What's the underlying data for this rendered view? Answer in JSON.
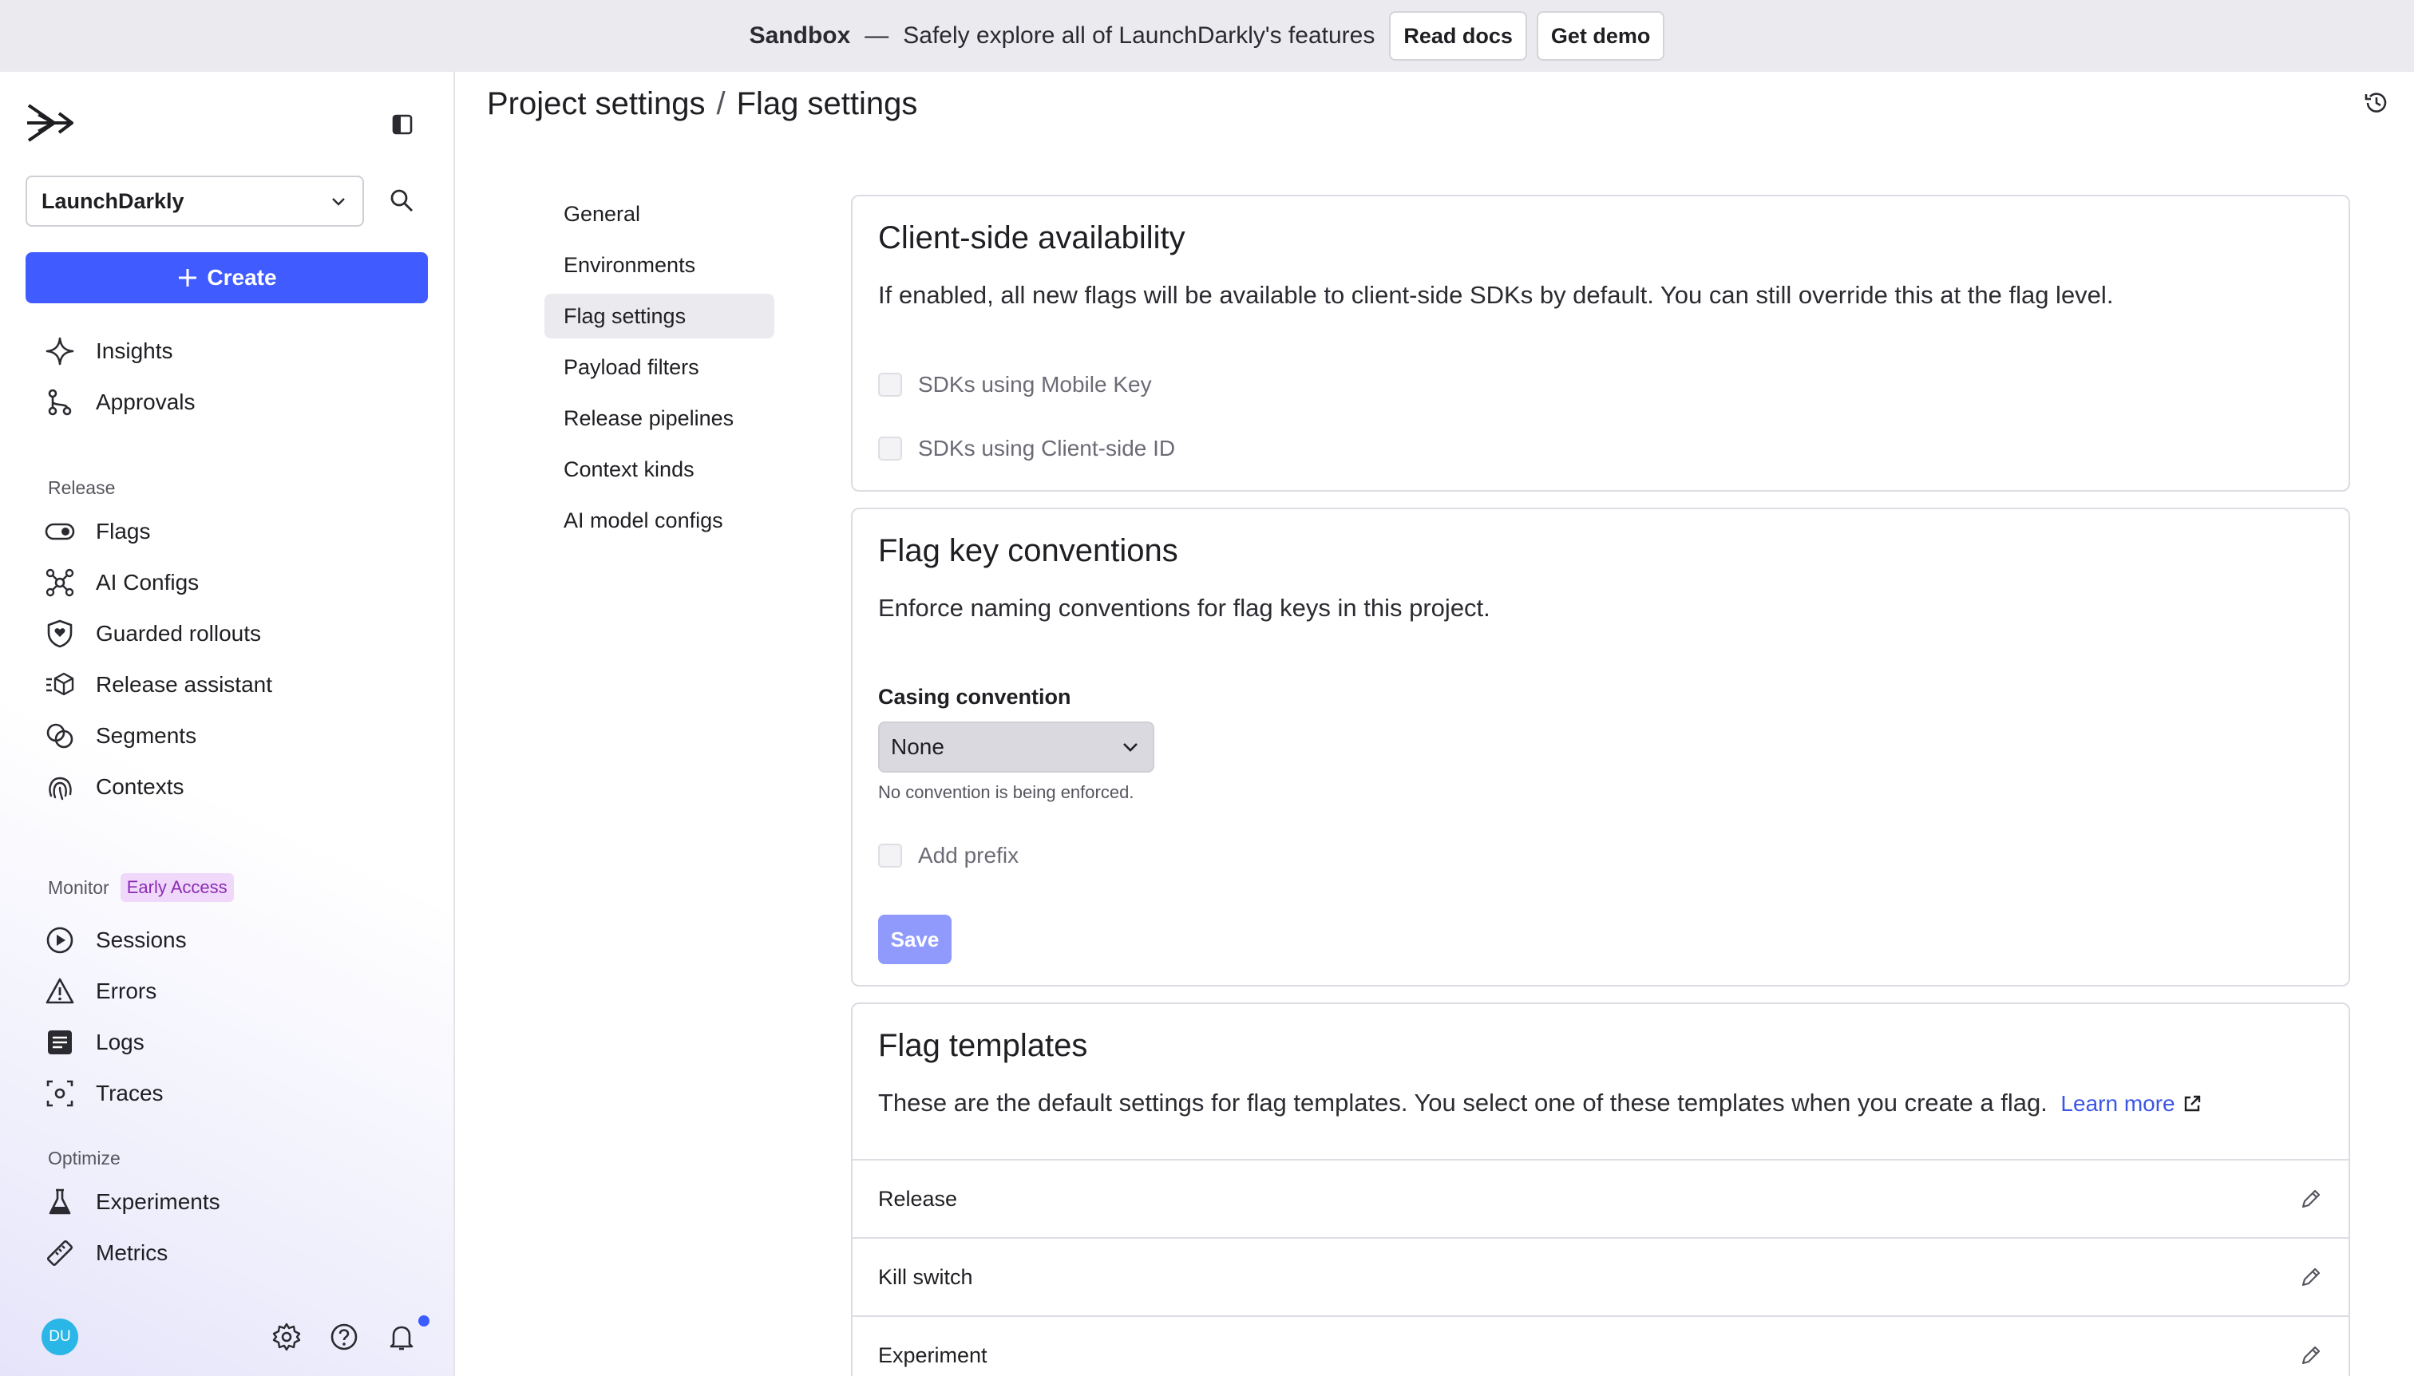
{
  "banner": {
    "title": "Sandbox",
    "dash": "—",
    "subtitle": "Safely explore all of LaunchDarkly's features",
    "read_docs": "Read docs",
    "get_demo": "Get demo"
  },
  "sidebar": {
    "project": "LaunchDarkly",
    "create_label": "Create",
    "top_items": [
      {
        "label": "Insights",
        "icon": "sparkle-icon"
      },
      {
        "label": "Approvals",
        "icon": "branch-icon"
      }
    ],
    "release_label": "Release",
    "release_items": [
      {
        "label": "Flags",
        "icon": "toggle-icon"
      },
      {
        "label": "AI Configs",
        "icon": "ai-config-icon"
      },
      {
        "label": "Guarded rollouts",
        "icon": "shield-icon"
      },
      {
        "label": "Release assistant",
        "icon": "cube-icon"
      },
      {
        "label": "Segments",
        "icon": "segments-icon"
      },
      {
        "label": "Contexts",
        "icon": "fingerprint-icon"
      }
    ],
    "monitor_label": "Monitor",
    "monitor_badge": "Early Access",
    "monitor_items": [
      {
        "label": "Sessions",
        "icon": "play-icon"
      },
      {
        "label": "Errors",
        "icon": "warning-icon"
      },
      {
        "label": "Logs",
        "icon": "logs-icon"
      },
      {
        "label": "Traces",
        "icon": "traces-icon"
      }
    ],
    "optimize_label": "Optimize",
    "optimize_items": [
      {
        "label": "Experiments",
        "icon": "flask-icon"
      },
      {
        "label": "Metrics",
        "icon": "ruler-icon"
      }
    ],
    "avatar_initials": "DU"
  },
  "breadcrumb": {
    "parent": "Project settings",
    "separator": "/",
    "current": "Flag settings"
  },
  "subnav": [
    "General",
    "Environments",
    "Flag settings",
    "Payload filters",
    "Release pipelines",
    "Context kinds",
    "AI model configs"
  ],
  "client_side": {
    "title": "Client-side availability",
    "description": "If enabled, all new flags will be available to client-side SDKs by default. You can still override this at the flag level.",
    "options": [
      "SDKs using Mobile Key",
      "SDKs using Client-side ID"
    ]
  },
  "key_conventions": {
    "title": "Flag key conventions",
    "description": "Enforce naming conventions for flag keys in this project.",
    "casing_label": "Casing convention",
    "casing_value": "None",
    "casing_hint": "No convention is being enforced.",
    "prefix_label": "Add prefix",
    "save_label": "Save"
  },
  "templates": {
    "title": "Flag templates",
    "description": "These are the default settings for flag templates. You select one of these templates when you create a flag.",
    "learn_more": "Learn more",
    "rows": [
      "Release",
      "Kill switch",
      "Experiment"
    ]
  },
  "colors": {
    "primary": "#405bff",
    "banner_bg": "#ebebef",
    "badge_bg": "#f0d8fb",
    "badge_text": "#8a2bb3",
    "save_disabled": "#8f9afc"
  }
}
